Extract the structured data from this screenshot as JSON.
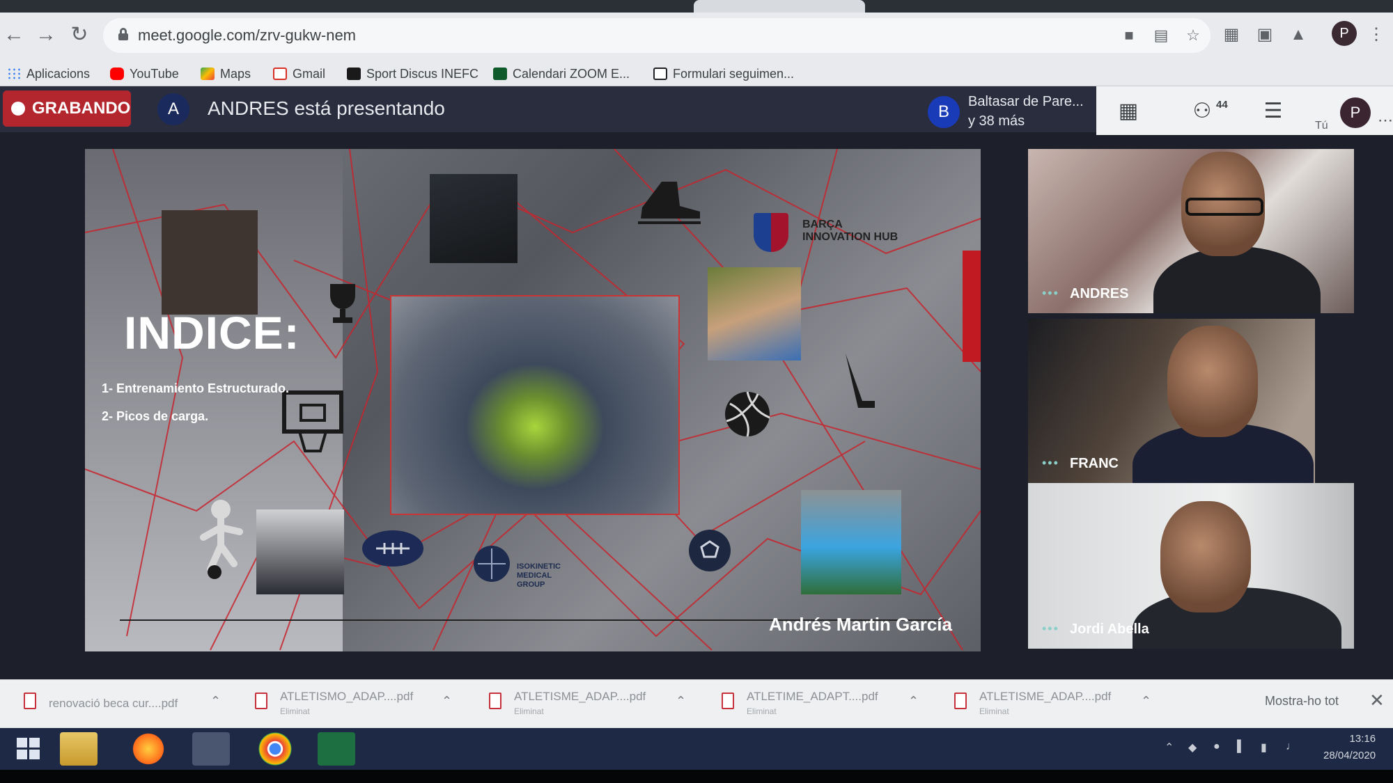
{
  "browser": {
    "url": "meet.google.com/zrv-gukw-nem",
    "profile_initial": "P",
    "bookmarks": [
      {
        "label": "Aplicacions",
        "icon": "apps-grid-icon",
        "color": "#4285f4"
      },
      {
        "label": "YouTube",
        "icon": "youtube-icon",
        "color": "#ff0000"
      },
      {
        "label": "Maps",
        "icon": "maps-icon",
        "color": "#34a853"
      },
      {
        "label": "Gmail",
        "icon": "gmail-icon",
        "color": "#d93025"
      },
      {
        "label": "Sport Discus INEFC",
        "icon": "bookmark-logo-icon",
        "color": "#1a1a1a"
      },
      {
        "label": "Calendari ZOOM E...",
        "icon": "bookmark-calendar-icon",
        "color": "#0f5a2a"
      },
      {
        "label": "Formulari seguimen...",
        "icon": "form-icon",
        "color": "#202124"
      }
    ]
  },
  "meet": {
    "recording_label": "GRABANDO",
    "presenter_initial": "A",
    "presenting_text": "ANDRES está presentando",
    "other_initial": "B",
    "others_line1": "Baltasar de Pare...",
    "others_line2": "y 38 más",
    "participant_count": "44",
    "self_label": "Tú",
    "self_initial": "P",
    "accent_color": "#b3262d"
  },
  "slide": {
    "title": "INDICE:",
    "points": [
      "1- Entrenamiento Estructurado.",
      "2- Picos de carga."
    ],
    "signature": "Andrés Martin García",
    "barca_text": [
      "BARÇA",
      "INNOVATION HUB"
    ],
    "isokinetic_text": [
      "ISOKINETIC",
      "MEDICAL",
      "GROUP"
    ]
  },
  "participants": [
    {
      "name": "ANDRES"
    },
    {
      "name": "FRANC"
    },
    {
      "name": "Jordi Abella"
    }
  ],
  "downloads": {
    "items": [
      {
        "name": "renovació beca cur....pdf",
        "status": ""
      },
      {
        "name": "ATLETISMO_ADAP....pdf",
        "status": "Eliminat"
      },
      {
        "name": "ATLETISME_ADAP....pdf",
        "status": "Eliminat"
      },
      {
        "name": "ATLETIME_ADAPT....pdf",
        "status": "Eliminat"
      },
      {
        "name": "ATLETISME_ADAP....pdf",
        "status": "Eliminat"
      }
    ],
    "show_all": "Mostra-ho tot"
  },
  "taskbar": {
    "time": "13:16",
    "date": "28/04/2020"
  }
}
